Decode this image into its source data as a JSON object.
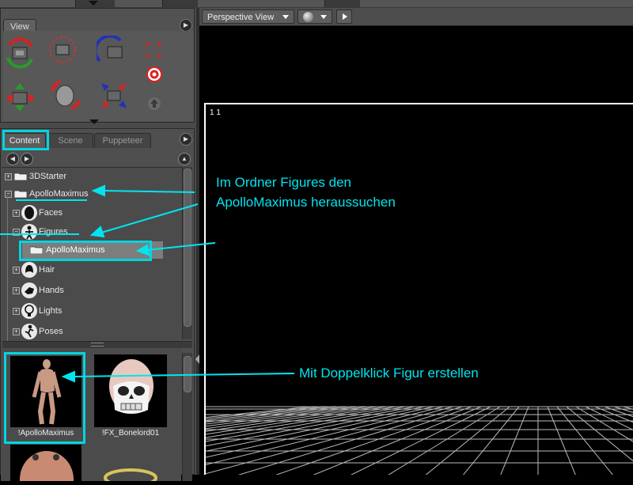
{
  "colors": {
    "highlight": "#00d5e0",
    "annotation": "#00e5f0",
    "panel": "#4f4f4f"
  },
  "view_panel": {
    "tab": "View",
    "icons": [
      "rotate-icon",
      "trackball-icon",
      "twist-icon",
      "frame-icon",
      "move-xy-icon",
      "chicken-icon",
      "move-xz-icon",
      "target-icon",
      "scale-icon",
      "up-arrow-icon"
    ]
  },
  "content_panel": {
    "tabs": [
      "Content",
      "Scene",
      "Puppeteer"
    ],
    "active_tab": "Content",
    "tree": [
      {
        "label": "3DStarter",
        "expander": "+",
        "icon": "folder-icon"
      },
      {
        "label": "ApolloMaximus",
        "expander": "−",
        "icon": "folder-icon"
      },
      {
        "label": "Faces",
        "expander": "+",
        "icon": "face-icon"
      },
      {
        "label": "Figures",
        "expander": "−",
        "icon": "figure-icon"
      },
      {
        "label": "ApolloMaximus",
        "expander": "",
        "icon": "folder-icon",
        "selected": true
      },
      {
        "label": "Hair",
        "expander": "+",
        "icon": "hair-icon"
      },
      {
        "label": "Hands",
        "expander": "+",
        "icon": "hand-icon"
      },
      {
        "label": "Lights",
        "expander": "+",
        "icon": "bulb-icon"
      },
      {
        "label": "Poses",
        "expander": "+",
        "icon": "pose-icon"
      }
    ],
    "library": [
      {
        "label": "!ApolloMaximus"
      },
      {
        "label": "!FX_Bonelord01"
      }
    ]
  },
  "viewport": {
    "camera_dropdown": "Perspective View",
    "coords": "1   1"
  },
  "annotations": {
    "folder_hint": "Im Ordner Figures den\nApolloMaximus heraussuchen",
    "folder_hint_line1": "Im Ordner Figures den",
    "folder_hint_line2": "ApolloMaximus heraussuchen",
    "double_click_hint": "Mit Doppelklick Figur erstellen"
  }
}
